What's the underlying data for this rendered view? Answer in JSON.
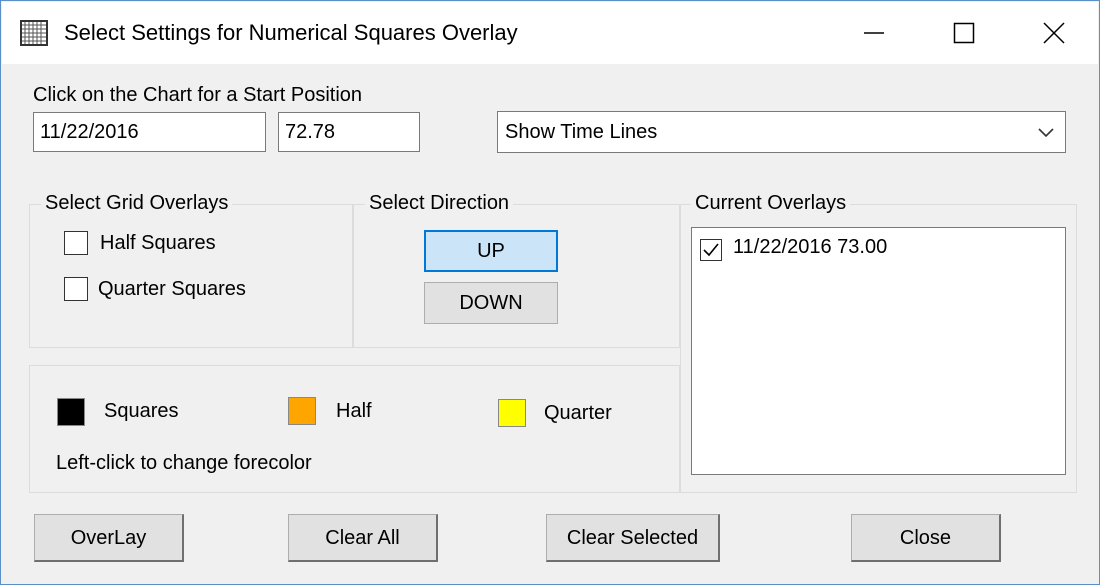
{
  "window": {
    "title": "Select Settings for Numerical Squares Overlay",
    "app_icon": "grid-icon",
    "controls": [
      "minimize-icon",
      "maximize-icon",
      "close-icon"
    ]
  },
  "start_position": {
    "label": "Click on the Chart for a Start Position",
    "date_value": "11/22/2016",
    "price_value": "72.78"
  },
  "time_lines_dropdown": {
    "selected": "Show Time Lines",
    "icon": "chevron-down-icon"
  },
  "grid_overlays": {
    "title": "Select Grid Overlays",
    "options": [
      {
        "label": "Half Squares",
        "checked": false
      },
      {
        "label": "Quarter Squares",
        "checked": false
      }
    ]
  },
  "direction": {
    "title": "Select Direction",
    "up_label": "UP",
    "down_label": "DOWN",
    "selected": "UP"
  },
  "colors": {
    "items": [
      {
        "label": "Squares",
        "color": "#000000"
      },
      {
        "label": "Half",
        "color": "#ffa500"
      },
      {
        "label": "Quarter",
        "color": "#ffff00"
      }
    ],
    "hint": "Left-click to change forecolor"
  },
  "current_overlays": {
    "title": "Current Overlays",
    "items": [
      {
        "label": "11/22/2016 73.00",
        "checked": true
      }
    ]
  },
  "buttons": {
    "overlay": "OverLay",
    "clear_all": "Clear All",
    "clear_selected": "Clear Selected",
    "close": "Close"
  }
}
